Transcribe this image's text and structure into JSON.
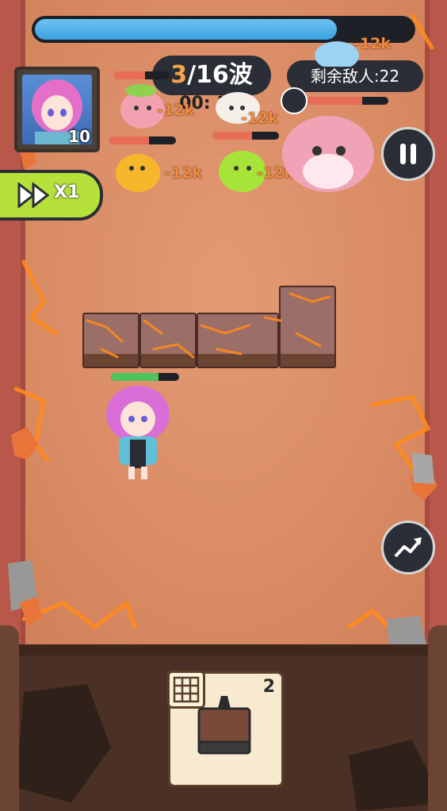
{
  "top": {
    "wave_progress": 0.8,
    "wave_current": "3",
    "wave_sep": "/16波",
    "timer": "00: 16",
    "enemies_remaining": "剩余敌人:22"
  },
  "player": {
    "level": "10",
    "hp_fraction": 0.7
  },
  "controls": {
    "speed_label": "X1",
    "pause_icon": "pause-icon",
    "upgrade_icon": "trending-up-icon"
  },
  "enemies": [
    {
      "name": "pink-octopus",
      "damage": "-12k",
      "hp": 0.55
    },
    {
      "name": "white-sheep",
      "damage": "-12k",
      "hp": 0.6
    },
    {
      "name": "blue-ghost",
      "damage": "-12k",
      "hp": 0.6
    },
    {
      "name": "orange-slime",
      "damage": "-12k",
      "hp": 0.6
    },
    {
      "name": "green-slime",
      "damage": "-12k",
      "hp": 0.6
    },
    {
      "name": "pink-boss",
      "hp": 0.68
    }
  ],
  "card": {
    "count": "2",
    "icon": "grid-icon",
    "item": "spike-block"
  },
  "colors": {
    "accent": "#f4a64a",
    "progress": "#4aa9e6",
    "speed": "#b5e13a",
    "hp": "#e86d57"
  }
}
